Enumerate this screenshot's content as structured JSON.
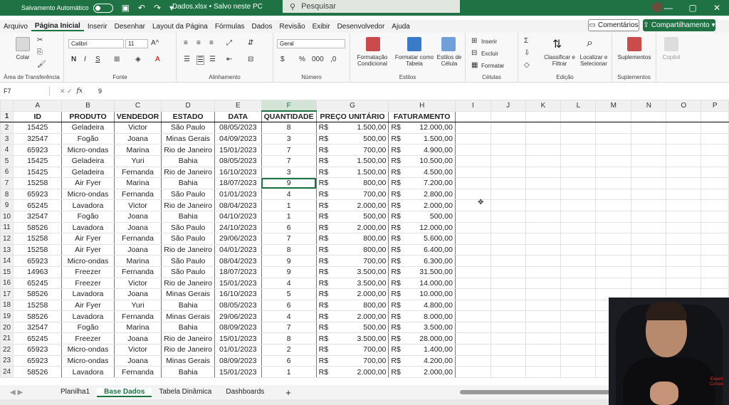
{
  "titlebar": {
    "autosave_label": "Salvamento Automático",
    "filename": "Dados.xlsx • Salvo neste PC",
    "search_placeholder": "Pesquisar"
  },
  "menu": [
    "Arquivo",
    "Página Inicial",
    "Inserir",
    "Desenhar",
    "Layout da Página",
    "Fórmulas",
    "Dados",
    "Revisão",
    "Exibir",
    "Desenvolvedor",
    "Ajuda"
  ],
  "comentarios": "Comentários",
  "compartilhamento": "Compartilhamento",
  "ribbon": {
    "clipboard": {
      "colar": "Colar",
      "label": "Área de Transferência"
    },
    "font": {
      "name": "Calibri",
      "size": "11",
      "bold": "N",
      "italic": "I",
      "underline": "S",
      "label": "Fonte"
    },
    "align": {
      "label": "Alinhamento"
    },
    "number": {
      "format": "Geral",
      "label": "Número"
    },
    "styles": {
      "cond": "Formatação Condicional",
      "table": "Formatar como Tabela",
      "cell": "Estilos de Célula",
      "label": "Estilos"
    },
    "cells": {
      "insert": "Inserir",
      "delete": "Excluir",
      "format": "Formatar",
      "label": "Células"
    },
    "editing": {
      "sort": "Classificar e Filtrar",
      "find": "Localizar e Selecionar",
      "label": "Edição"
    },
    "addins": {
      "name": "Suplementos",
      "label": "Suplementos"
    },
    "copilot": "Copilot"
  },
  "formula_bar": {
    "cell": "F7",
    "value": "9"
  },
  "columns": [
    "A",
    "B",
    "C",
    "D",
    "E",
    "F",
    "G",
    "H",
    "I",
    "J",
    "K",
    "L",
    "M",
    "N",
    "O",
    "P"
  ],
  "headers": [
    "ID",
    "PRODUTO",
    "VENDEDOR",
    "ESTADO",
    "DATA",
    "QUANTIDADE",
    "PREÇO UNITÁRIO",
    "FATURAMENTO"
  ],
  "currency": "R$",
  "rows": [
    [
      "15425",
      "Geladeira",
      "Victor",
      "São Paulo",
      "08/05/2023",
      "8",
      "1.500,00",
      "12.000,00"
    ],
    [
      "32547",
      "Fogão",
      "Joana",
      "Minas Gerais",
      "04/09/2023",
      "3",
      "500,00",
      "1.500,00"
    ],
    [
      "65923",
      "Micro-ondas",
      "Marina",
      "Rio de Janeiro",
      "15/01/2023",
      "7",
      "700,00",
      "4.900,00"
    ],
    [
      "15425",
      "Geladeira",
      "Yuri",
      "Bahia",
      "08/05/2023",
      "7",
      "1.500,00",
      "10.500,00"
    ],
    [
      "15425",
      "Geladeira",
      "Fernanda",
      "Rio de Janeiro",
      "16/10/2023",
      "3",
      "1.500,00",
      "4.500,00"
    ],
    [
      "15258",
      "Air Fyer",
      "Marina",
      "Bahia",
      "18/07/2023",
      "9",
      "800,00",
      "7.200,00"
    ],
    [
      "65923",
      "Micro-ondas",
      "Fernanda",
      "São Paulo",
      "01/01/2023",
      "4",
      "700,00",
      "2.800,00"
    ],
    [
      "65245",
      "Lavadora",
      "Victor",
      "Rio de Janeiro",
      "08/04/2023",
      "1",
      "2.000,00",
      "2.000,00"
    ],
    [
      "32547",
      "Fogão",
      "Joana",
      "Bahia",
      "04/10/2023",
      "1",
      "500,00",
      "500,00"
    ],
    [
      "58526",
      "Lavadora",
      "Joana",
      "São Paulo",
      "24/10/2023",
      "6",
      "2.000,00",
      "12.000,00"
    ],
    [
      "15258",
      "Air Fyer",
      "Fernanda",
      "São Paulo",
      "29/06/2023",
      "7",
      "800,00",
      "5.600,00"
    ],
    [
      "15258",
      "Air Fyer",
      "Joana",
      "Rio de Janeiro",
      "04/01/2023",
      "8",
      "800,00",
      "6.400,00"
    ],
    [
      "65923",
      "Micro-ondas",
      "Marina",
      "São Paulo",
      "08/04/2023",
      "9",
      "700,00",
      "6.300,00"
    ],
    [
      "14963",
      "Freezer",
      "Fernanda",
      "São Paulo",
      "18/07/2023",
      "9",
      "3.500,00",
      "31.500,00"
    ],
    [
      "65245",
      "Freezer",
      "Victor",
      "Rio de Janeiro",
      "15/01/2023",
      "4",
      "3.500,00",
      "14.000,00"
    ],
    [
      "58526",
      "Lavadora",
      "Joana",
      "Minas Gerais",
      "16/10/2023",
      "5",
      "2.000,00",
      "10.000,00"
    ],
    [
      "15258",
      "Air Fyer",
      "Yuri",
      "Bahia",
      "08/05/2023",
      "6",
      "800,00",
      "4.800,00"
    ],
    [
      "58526",
      "Lavadora",
      "Fernanda",
      "Minas Gerais",
      "29/06/2023",
      "4",
      "2.000,00",
      "8.000,00"
    ],
    [
      "32547",
      "Fogão",
      "Marina",
      "Bahia",
      "08/09/2023",
      "7",
      "500,00",
      "3.500,00"
    ],
    [
      "65245",
      "Freezer",
      "Joana",
      "Rio de Janeiro",
      "15/01/2023",
      "8",
      "3.500,00",
      "28.000,00"
    ],
    [
      "65923",
      "Micro-ondas",
      "Victor",
      "Rio de Janeiro",
      "01/01/2023",
      "2",
      "700,00",
      "1.400,00"
    ],
    [
      "65923",
      "Micro-ondas",
      "Joana",
      "Minas Gerais",
      "08/09/2023",
      "6",
      "700,00",
      "4.200,00"
    ],
    [
      "58526",
      "Lavadora",
      "Fernanda",
      "Bahia",
      "15/01/2023",
      "1",
      "2.000,00",
      "2.000,00"
    ]
  ],
  "sheets": [
    "Planilha1",
    "Base Dados",
    "Tabela Dinâmica",
    "Dashboards"
  ],
  "active_sheet": "Base Dados",
  "webcam_logo": "Expert Cursos",
  "accent": "#1f7244"
}
